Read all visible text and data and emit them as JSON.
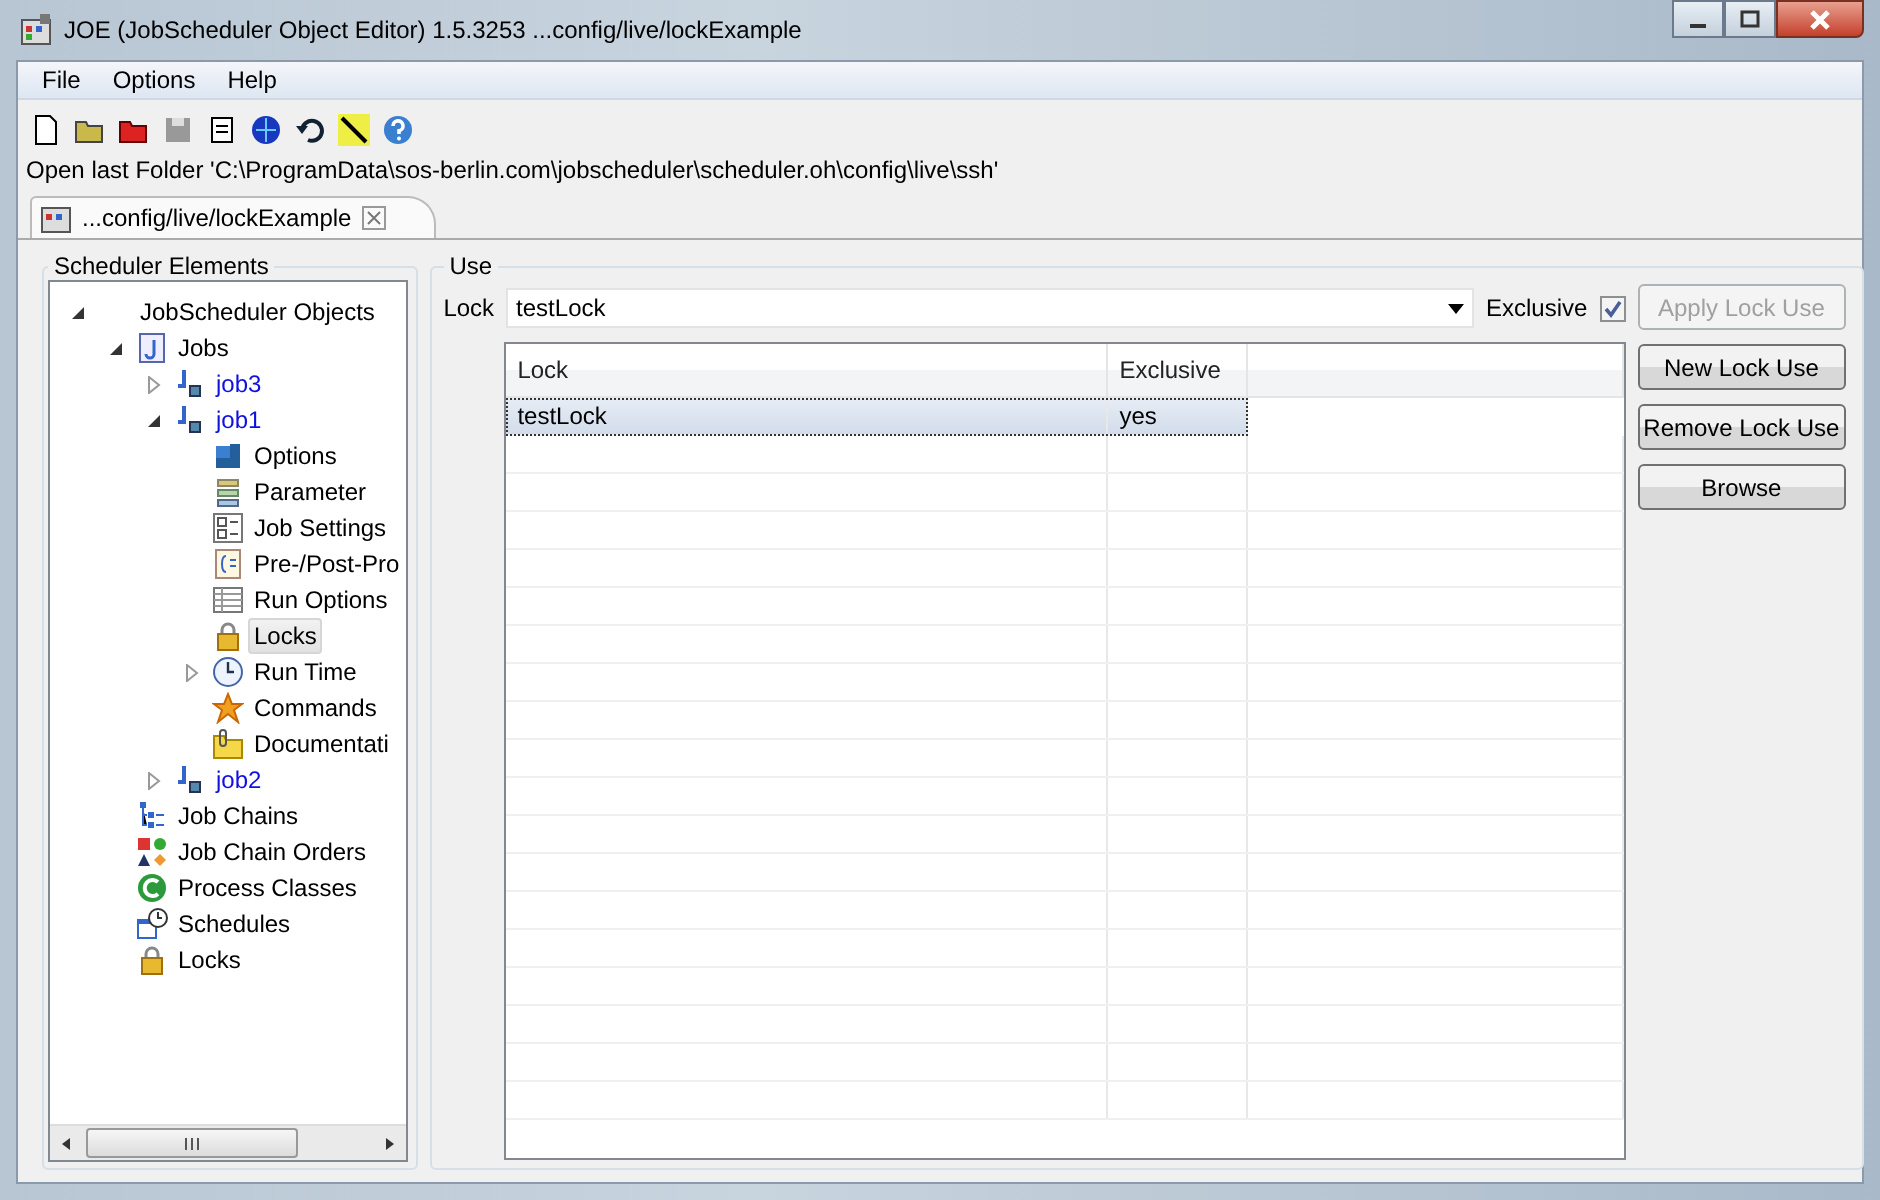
{
  "window": {
    "title": "JOE (JobScheduler Object Editor) 1.5.3253 ...config/live/lockExample"
  },
  "menu": [
    "File",
    "Options",
    "Help"
  ],
  "last_folder": "Open last Folder 'C:\\ProgramData\\sos-berlin.com\\jobscheduler\\scheduler.oh\\config\\live\\ssh'",
  "tabs": [
    {
      "label": "...config/live/lockExample",
      "selected": true
    }
  ],
  "tree_panel": {
    "title": "Scheduler Elements",
    "tree": [
      {
        "label": "JobScheduler Objects",
        "expanded": true,
        "selected": false,
        "children": [
          {
            "label": "Jobs",
            "kind": "jobs",
            "expanded": true,
            "selected": false,
            "children": [
              {
                "label": "job3",
                "kind": "job",
                "expanded": false,
                "selected": false
              },
              {
                "label": "job1",
                "kind": "job",
                "expanded": true,
                "selected": false,
                "children": [
                  {
                    "label": "Options",
                    "kind": "options",
                    "selected": false
                  },
                  {
                    "label": "Parameter",
                    "kind": "parameter",
                    "selected": false
                  },
                  {
                    "label": "Job Settings",
                    "kind": "settings",
                    "selected": false
                  },
                  {
                    "label": "Pre-/Post-Pro",
                    "kind": "prepost",
                    "selected": false
                  },
                  {
                    "label": "Run Options",
                    "kind": "runoptions",
                    "selected": false
                  },
                  {
                    "label": "Locks",
                    "kind": "lock",
                    "selected": true
                  },
                  {
                    "label": "Run Time",
                    "kind": "runtime",
                    "expanded": false,
                    "selected": false
                  },
                  {
                    "label": "Commands",
                    "kind": "commands",
                    "selected": false
                  },
                  {
                    "label": "Documentati",
                    "kind": "docs",
                    "selected": false
                  }
                ]
              },
              {
                "label": "job2",
                "kind": "job",
                "expanded": false,
                "selected": false
              }
            ]
          },
          {
            "label": "Job Chains",
            "kind": "jobchains",
            "selected": false
          },
          {
            "label": "Job Chain Orders",
            "kind": "orders",
            "selected": false
          },
          {
            "label": "Process Classes",
            "kind": "process",
            "selected": false
          },
          {
            "label": "Schedules",
            "kind": "schedules",
            "selected": false
          },
          {
            "label": "Locks",
            "kind": "lock",
            "selected": false
          }
        ]
      }
    ]
  },
  "use_panel": {
    "title": "Use",
    "lock_label": "Lock",
    "lock_value": "testLock",
    "exclusive_label": "Exclusive",
    "exclusive_checked": true,
    "buttons": [
      {
        "label": "Apply Lock Use",
        "disabled": true
      },
      {
        "label": "New Lock Use",
        "disabled": false
      },
      {
        "label": "Remove Lock Use",
        "disabled": false
      },
      {
        "label": "Browse",
        "disabled": false
      }
    ],
    "table": {
      "columns": [
        "Lock",
        "Exclusive"
      ],
      "rows": [
        {
          "cells": [
            "testLock",
            "yes"
          ],
          "selected": true
        }
      ]
    }
  }
}
